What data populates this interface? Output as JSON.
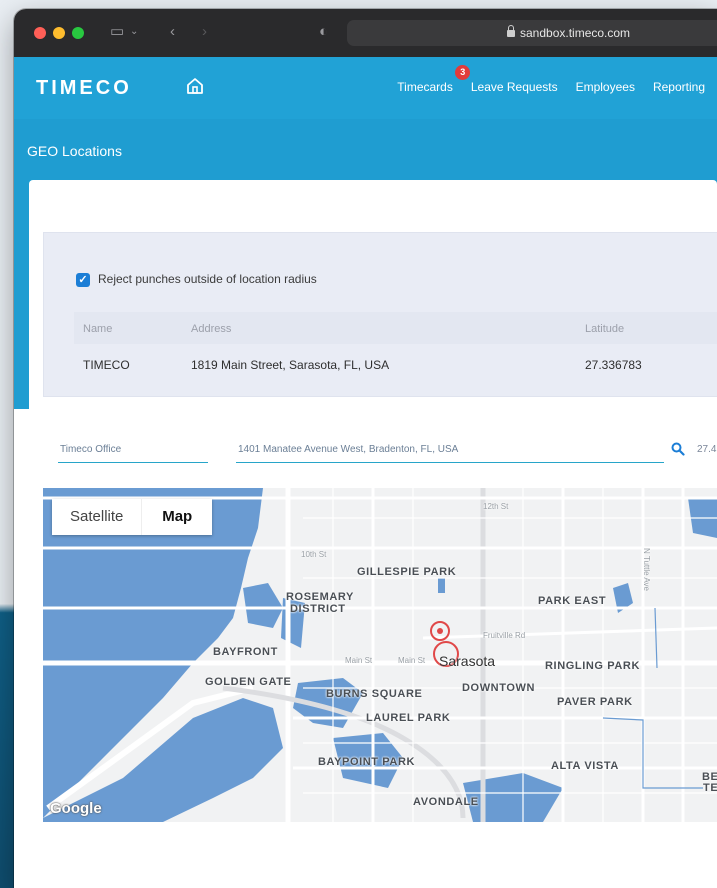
{
  "browser": {
    "url": "sandbox.timeco.com"
  },
  "nav": {
    "logo": "TIMECO",
    "links": [
      {
        "label": "Timecards",
        "badge": "3"
      },
      {
        "label": "Leave Requests"
      },
      {
        "label": "Employees"
      },
      {
        "label": "Reporting"
      }
    ]
  },
  "page": {
    "title": "GEO Locations"
  },
  "settings": {
    "reject_label": "Reject punches outside of location radius",
    "reject_checked": true
  },
  "table": {
    "headers": [
      "Name",
      "Address",
      "Latitude"
    ],
    "rows": [
      {
        "name": "TIMECO",
        "address": "1819 Main Street, Sarasota, FL, USA",
        "latitude": "27.336783"
      }
    ]
  },
  "new_location": {
    "name_value": "Timeco Office",
    "address_value": "1401 Manatee Avenue West, Bradenton, FL, USA",
    "latitude_partial": "27.4"
  },
  "map": {
    "toggle": {
      "satellite": "Satellite",
      "map": "Map",
      "selected": "Map"
    },
    "labels": {
      "gillespie": "GILLESPIE PARK",
      "rosemary1": "ROSEMARY",
      "rosemary2": "DISTRICT",
      "parkeast": "PARK EAST",
      "bayfront": "BAYFRONT",
      "goldengate": "GOLDEN GATE",
      "burns": "BURNS SQUARE",
      "downtown": "DOWNTOWN",
      "ringling": "RINGLING PARK",
      "paver": "PAVER PARK",
      "laurel": "LAUREL PARK",
      "baypoint": "BAYPOINT PARK",
      "altavista": "ALTA VISTA",
      "avondale": "AVONDALE",
      "be": "BE",
      "te": "TE",
      "city": "Sarasota",
      "street_12th": "12th St",
      "street_10th": "10th St",
      "street_main1": "Main St",
      "street_main2": "Main St",
      "street_fruitville": "Fruitville Rd",
      "street_tuttle": "N Tuttle Ave"
    },
    "attribution": "Google",
    "water_color": "#6a9bd2",
    "land_color": "#f1f2f3",
    "marker_color": "#e04848"
  },
  "colors": {
    "brand": "#21a2d6",
    "checkbox": "#1c7ed6"
  }
}
